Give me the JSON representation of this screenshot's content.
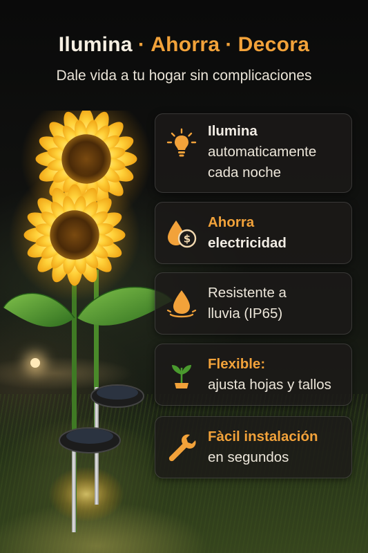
{
  "header": {
    "title_part1": "Ilumina",
    "separator": "·",
    "title_part2": "Ahorra",
    "title_part3": "Decora",
    "subtitle": "Dale vida a tu hogar sin complicaciones"
  },
  "colors": {
    "accent": "#f2a23a",
    "text": "#f1ece4",
    "card_bg": "#1c1a18"
  },
  "features": [
    {
      "icon": "light-bulb-icon",
      "line1": "Ilumina",
      "line2": "automaticamente",
      "line3": "cada noche"
    },
    {
      "icon": "water-drop-coin-icon",
      "line1": "Ahorra",
      "line2": "electricidad"
    },
    {
      "icon": "water-drop-icon",
      "line1": "Resistente a",
      "line2": "lluvia (IP65)"
    },
    {
      "icon": "sprout-icon",
      "line1": "Flexible:",
      "line2": "ajusta hojas y tallos"
    },
    {
      "icon": "wrench-icon",
      "line1": "Fàcil instalación",
      "line2": "en segundos"
    }
  ],
  "illustration": {
    "icon": "sunflower-solar-lights-illustration"
  }
}
